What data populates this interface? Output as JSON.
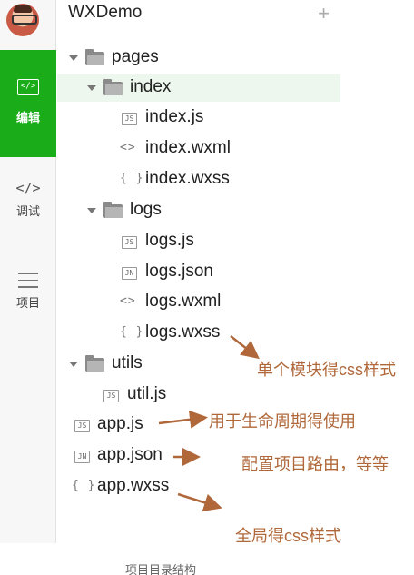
{
  "window": {
    "title": "WXDemo",
    "add_icon": "plus-icon"
  },
  "toolbar": {
    "edit_label": "编辑",
    "debug_label": "调试",
    "project_label": "项目",
    "edit_icon_glyph": "</>",
    "debug_icon_glyph": "</>"
  },
  "tree": {
    "pages": "pages",
    "index": "index",
    "index_js": "index.js",
    "index_wxml": "index.wxml",
    "index_wxss": "index.wxss",
    "logs": "logs",
    "logs_js": "logs.js",
    "logs_json": "logs.json",
    "logs_wxml": "logs.wxml",
    "logs_wxss": "logs.wxss",
    "utils": "utils",
    "util_js": "util.js",
    "app_js": "app.js",
    "app_json": "app.json",
    "app_wxss": "app.wxss"
  },
  "icons": {
    "js": "JS",
    "json": "JN",
    "wxml": "<>",
    "wxss": "{ }"
  },
  "annotations": {
    "module_style": "单个模块得css样式",
    "lifecycle": "用于生命周期得使用",
    "routing": "配置项目路由，等等",
    "global_style": "全局得css样式"
  },
  "caption": "项目目录结构",
  "colors": {
    "accent": "#1aad19",
    "annotation": "#b0683a"
  }
}
